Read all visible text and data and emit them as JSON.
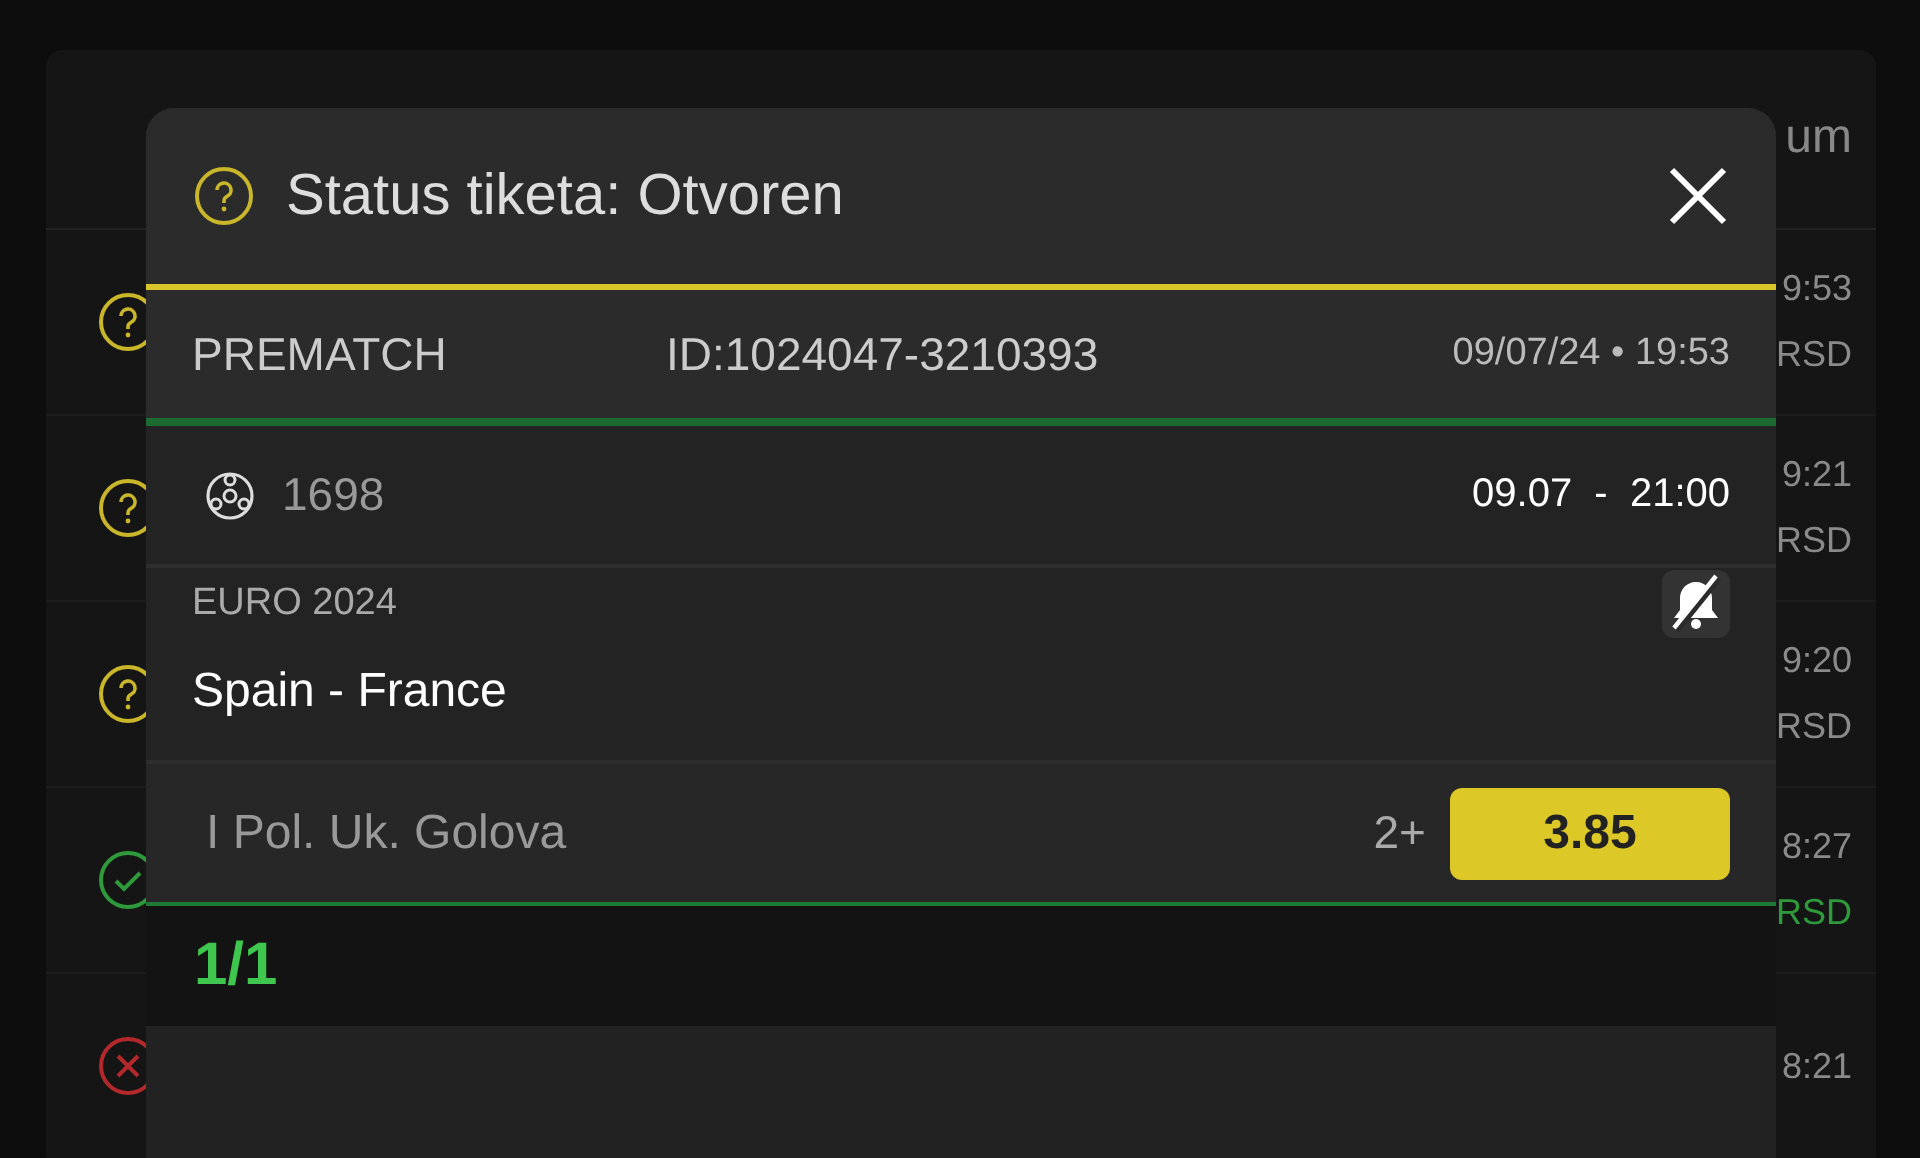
{
  "background_list": {
    "header": "um",
    "rows": [
      {
        "kind": "open",
        "time": "9:53",
        "currency": "RSD"
      },
      {
        "kind": "open",
        "time": "9:21",
        "currency": "RSD"
      },
      {
        "kind": "open",
        "time": "9:20",
        "currency": "RSD"
      },
      {
        "kind": "won",
        "time": "8:27",
        "currency": "RSD"
      },
      {
        "kind": "lost",
        "time": "8:21"
      }
    ]
  },
  "dialog": {
    "kind": "open",
    "title": "Status tiketa: Otvoren",
    "ticket": {
      "type": "PREMATCH",
      "id": "ID:1024047-3210393",
      "placed": "09/07/24 • 19:53"
    },
    "events": [
      {
        "kind": "football",
        "code": "1698",
        "start": "09.07  -  21:00",
        "league": "EURO 2024",
        "notifications": false,
        "match": "Spain - France",
        "market": "I Pol. Uk. Golova",
        "pick": "2+",
        "odds": "3.85"
      }
    ],
    "count": "1/1"
  }
}
